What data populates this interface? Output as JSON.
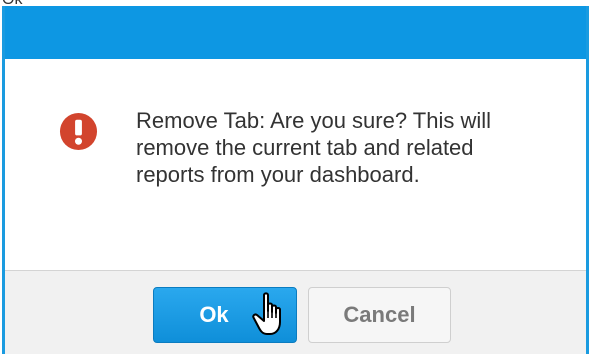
{
  "top_caption": "Ok",
  "dialog": {
    "message": "Remove Tab: Are you sure? This will remove the current tab and related reports from your dashboard.",
    "alert_icon": "exclamation-circle-icon",
    "colors": {
      "title_bar": "#0d97e3",
      "alert": "#d2442d",
      "ok_button": "#0f8fd9"
    },
    "buttons": {
      "ok_label": "Ok",
      "cancel_label": "Cancel"
    },
    "cursor_icon": "hand-pointer-icon"
  }
}
